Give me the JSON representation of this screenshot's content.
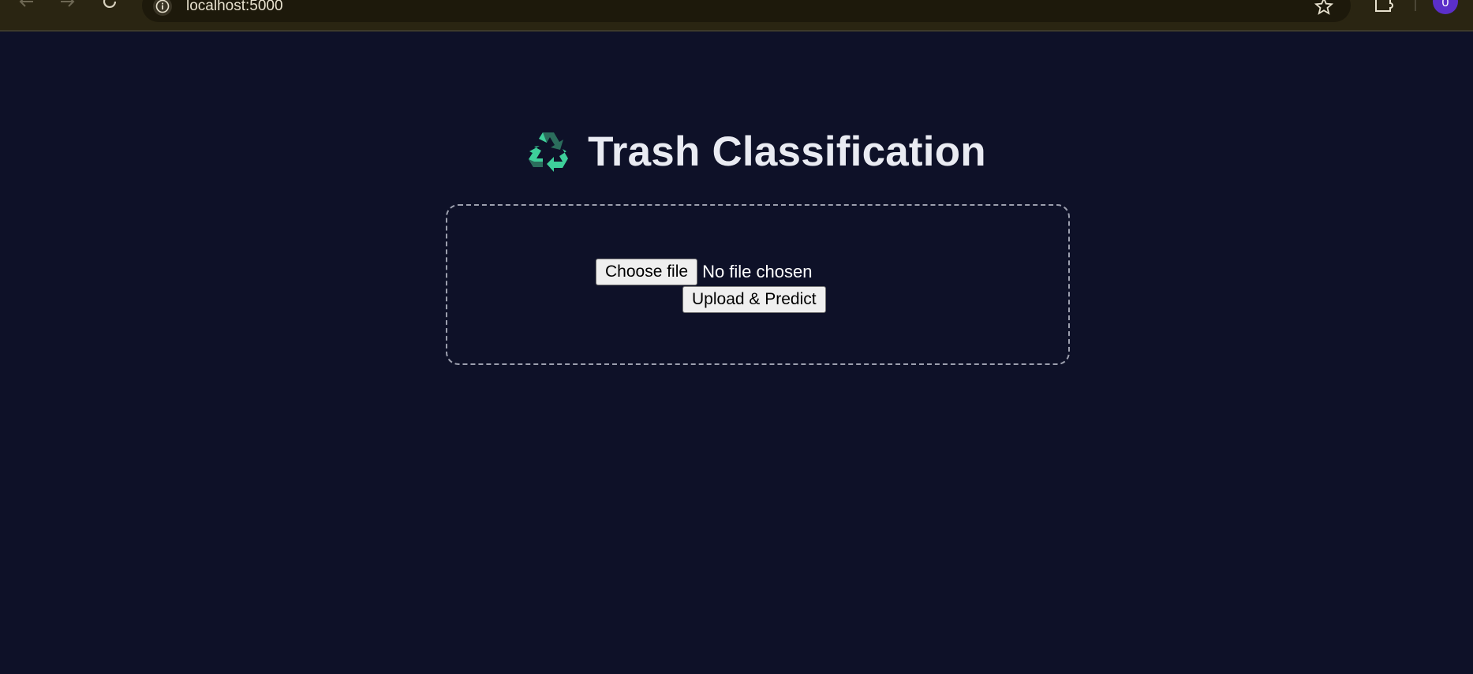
{
  "browser": {
    "url": "localhost:5000",
    "back_icon": "arrow-left-icon",
    "forward_icon": "arrow-right-icon",
    "reload_icon": "reload-icon",
    "site_info_icon": "info-icon",
    "bookmark_icon": "star-icon",
    "extensions_icon": "puzzle-icon",
    "profile_initial": "0"
  },
  "page": {
    "title_icon": "recycle-icon",
    "title": "Trash Classification",
    "choose_file_label": "Choose file",
    "file_status": "No file chosen",
    "submit_label": "Upload & Predict"
  },
  "colors": {
    "background": "#0e1128",
    "title_text": "#e9ebf2",
    "recycle_light": "#3ecf9a",
    "recycle_dark": "#2b6d5c",
    "box_border": "#9c9fae",
    "avatar": "#5b2fc9"
  }
}
